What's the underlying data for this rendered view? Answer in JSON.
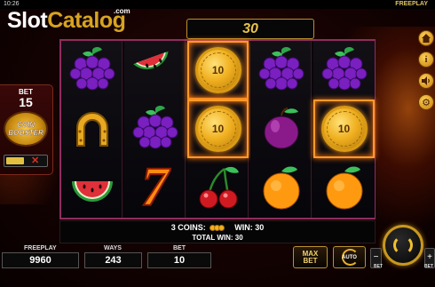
{
  "status_bar": {
    "time": "10:26",
    "mode": "FREEPLAY"
  },
  "logo": {
    "part1": "Slot",
    "part2": "Catalog",
    "suffix": ".com"
  },
  "win_banner": "30",
  "reels": [
    [
      "grapes-icon",
      "watermelon-icon",
      "grapes-icon",
      "grapes-icon",
      "grapes-icon"
    ],
    [
      "horseshoe-icon",
      "grapes-icon",
      "coin-icon",
      "plum-icon",
      "coin-icon"
    ],
    [
      "watermelon-icon",
      "seven-icon",
      "cherries-icon",
      "orange-icon",
      "orange-icon"
    ]
  ],
  "coin_values": {
    "r0c2": "10",
    "r1c2": "10",
    "r1c4": "10"
  },
  "result": {
    "coins_label": "3 COINS:",
    "win_label": "WIN: 30",
    "total_win": "TOTAL WIN: 30"
  },
  "booster": {
    "bet_label": "BET",
    "bet_value": "15",
    "title_line1": "COIN",
    "title_line2": "BOOSTER",
    "off_symbol": "✕"
  },
  "bottom": {
    "freeplay_label": "FREEPLAY",
    "freeplay_value": "9960",
    "ways_label": "WAYS",
    "ways_value": "243",
    "bet_label": "BET",
    "bet_value": "10",
    "maxbet_line1": "MAX",
    "maxbet_line2": "BET",
    "auto_label": "AUTO",
    "bet_minus": "−",
    "bet_plus": "+",
    "bet_small_left": "BET",
    "bet_small_right": "BET"
  },
  "side_icons": [
    "home-icon",
    "info-icon",
    "sound-icon",
    "settings-icon"
  ],
  "colors": {
    "gold": "#e8c24a",
    "frame": "#8f2d5e",
    "highlight": "#ff9a2a"
  }
}
